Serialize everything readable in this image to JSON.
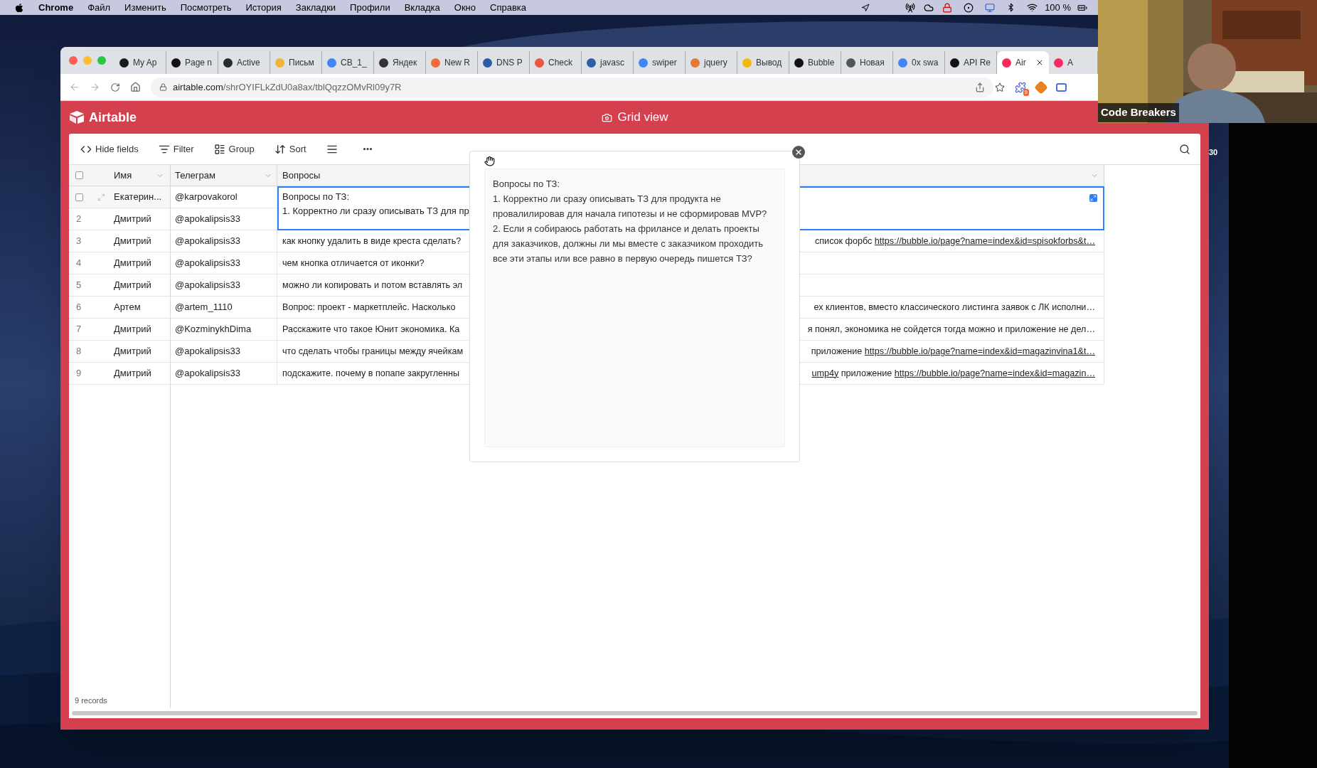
{
  "menu_bar": {
    "app": "Chrome",
    "items": [
      "Файл",
      "Изменить",
      "Посмотреть",
      "История",
      "Закладки",
      "Профили",
      "Вкладка",
      "Окно",
      "Справка"
    ],
    "battery": "100 %"
  },
  "browser": {
    "tabs": [
      {
        "title": "My Ap",
        "selected": false,
        "color": "#1a1a1a"
      },
      {
        "title": "Page n",
        "selected": false,
        "color": "#111111"
      },
      {
        "title": "Active",
        "selected": false,
        "color": "#2a2a2a"
      },
      {
        "title": "Письм",
        "selected": false,
        "color": "#f2b233"
      },
      {
        "title": "CB_1_",
        "selected": false,
        "color": "#4285f4"
      },
      {
        "title": "Яндек",
        "selected": false,
        "color": "#333333"
      },
      {
        "title": "New R",
        "selected": false,
        "color": "#f26b3a"
      },
      {
        "title": "DNS P",
        "selected": false,
        "color": "#2b5aa8"
      },
      {
        "title": "Check",
        "selected": false,
        "color": "#e8573f"
      },
      {
        "title": "javasc",
        "selected": false,
        "color": "#2f5fa6"
      },
      {
        "title": "swiper",
        "selected": false,
        "color": "#4285f4"
      },
      {
        "title": "jquery",
        "selected": false,
        "color": "#e37933"
      },
      {
        "title": "Вывод",
        "selected": false,
        "color": "#f0b90b"
      },
      {
        "title": "Bubble",
        "selected": false,
        "color": "#111111"
      },
      {
        "title": "Новая",
        "selected": false,
        "color": "#555555"
      },
      {
        "title": "0x swa",
        "selected": false,
        "color": "#4285f4"
      },
      {
        "title": "API Re",
        "selected": false,
        "color": "#111111"
      },
      {
        "title": "Air",
        "selected": true,
        "color": "#f82b60"
      },
      {
        "title": "A",
        "selected": false,
        "color": "#f82b60"
      }
    ],
    "address": {
      "host": "airtable.com",
      "path": "/shrOYIFLkZdU0a8ax/tblQqzzOMvRl09y7R"
    },
    "extension_badge": "9"
  },
  "airtable": {
    "brand": "Airtable",
    "view_title": "Grid view",
    "toolbar": [
      {
        "kind": "hide",
        "label": "Hide fields"
      },
      {
        "kind": "filter",
        "label": "Filter"
      },
      {
        "kind": "group",
        "label": "Group"
      },
      {
        "kind": "sort",
        "label": "Sort"
      },
      {
        "kind": "row_height"
      },
      {
        "kind": "more"
      }
    ],
    "columns": [
      "Имя",
      "Телеграм",
      "Вопросы"
    ],
    "all_checked": false,
    "rows": [
      {
        "hovered": true,
        "checked": false,
        "name": "Екатерин...",
        "telegram": "@karpovakorol",
        "expanded": true,
        "question_lines": [
          "Вопросы по ТЗ:",
          "1. Корректно ли сразу описывать ТЗ для пр"
        ]
      },
      {
        "number": "2",
        "hovered": false,
        "name": "Дмитрий",
        "telegram": "@apokalipsis33",
        "expanded": false
      },
      {
        "number": "3",
        "hovered": false,
        "name": "Дмитрий",
        "telegram": "@apokalipsis33",
        "expanded": false,
        "question_start": "как кнопку удалить в виде креста сделать?",
        "question_end": [
          {
            "text": "список форбс ",
            "link": false
          },
          {
            "text": "https://bubble.io/page?name=index&id=spisokforbs&t…",
            "link": true
          }
        ]
      },
      {
        "number": "4",
        "hovered": false,
        "name": "Дмитрий",
        "telegram": "@apokalipsis33",
        "expanded": false,
        "question_start": "чем кнопка отличается от иконки?"
      },
      {
        "number": "5",
        "hovered": false,
        "name": "Дмитрий",
        "telegram": "@apokalipsis33",
        "expanded": false,
        "question_start": "можно ли копировать и потом вставлять эл"
      },
      {
        "number": "6",
        "hovered": false,
        "name": "Артем",
        "telegram": "@artem_1110",
        "expanded": false,
        "question_start": "Вопрос: проект - маркетплейс. Насколько",
        "question_end": [
          {
            "text": "ех клиентов, вместо классического листинга заявок с ЛК исполни…",
            "link": false
          }
        ]
      },
      {
        "number": "7",
        "hovered": false,
        "name": "Дмитрий",
        "telegram": "@KozminykhDima",
        "expanded": false,
        "question_start": "Расскажите что такое Юнит экономика. Ка",
        "question_end": [
          {
            "text": "я понял, экономика не сойдется тогда можно и приложение не дел…",
            "link": false
          }
        ]
      },
      {
        "number": "8",
        "hovered": false,
        "name": "Дмитрий",
        "telegram": "@apokalipsis33",
        "expanded": false,
        "question_start": "что сделать чтобы границы между ячейкам",
        "question_end": [
          {
            "text": "приложение ",
            "link": false
          },
          {
            "text": "https://bubble.io/page?name=index&id=magazinvina1&t…",
            "link": true
          }
        ]
      },
      {
        "number": "9",
        "hovered": false,
        "name": "Дмитрий",
        "telegram": "@apokalipsis33",
        "expanded": false,
        "question_start": "подскажите. почему в попапе закругленны",
        "question_end": [
          {
            "text": "ump4y",
            "link": true
          },
          {
            "text": " приложение ",
            "link": false
          },
          {
            "text": "https://bubble.io/page?name=index&id=magazin…",
            "link": true
          }
        ]
      }
    ],
    "footer": "9 records",
    "popup": {
      "text": "Вопросы по ТЗ:\n1. Корректно ли сразу описывать ТЗ для продукта не провалилировав для начала гипотезы и не сформировав MVP?\n2. Если я собираюсь работать на фрилансе и делать проекты для заказчиков, должны ли мы вместе с заказчиком проходить все эти этапы или все равно в первую очередь пишется ТЗ?"
    }
  },
  "webcam": {
    "kind": "picture",
    "caption": "Code Breakers"
  },
  "side_number": "30"
}
